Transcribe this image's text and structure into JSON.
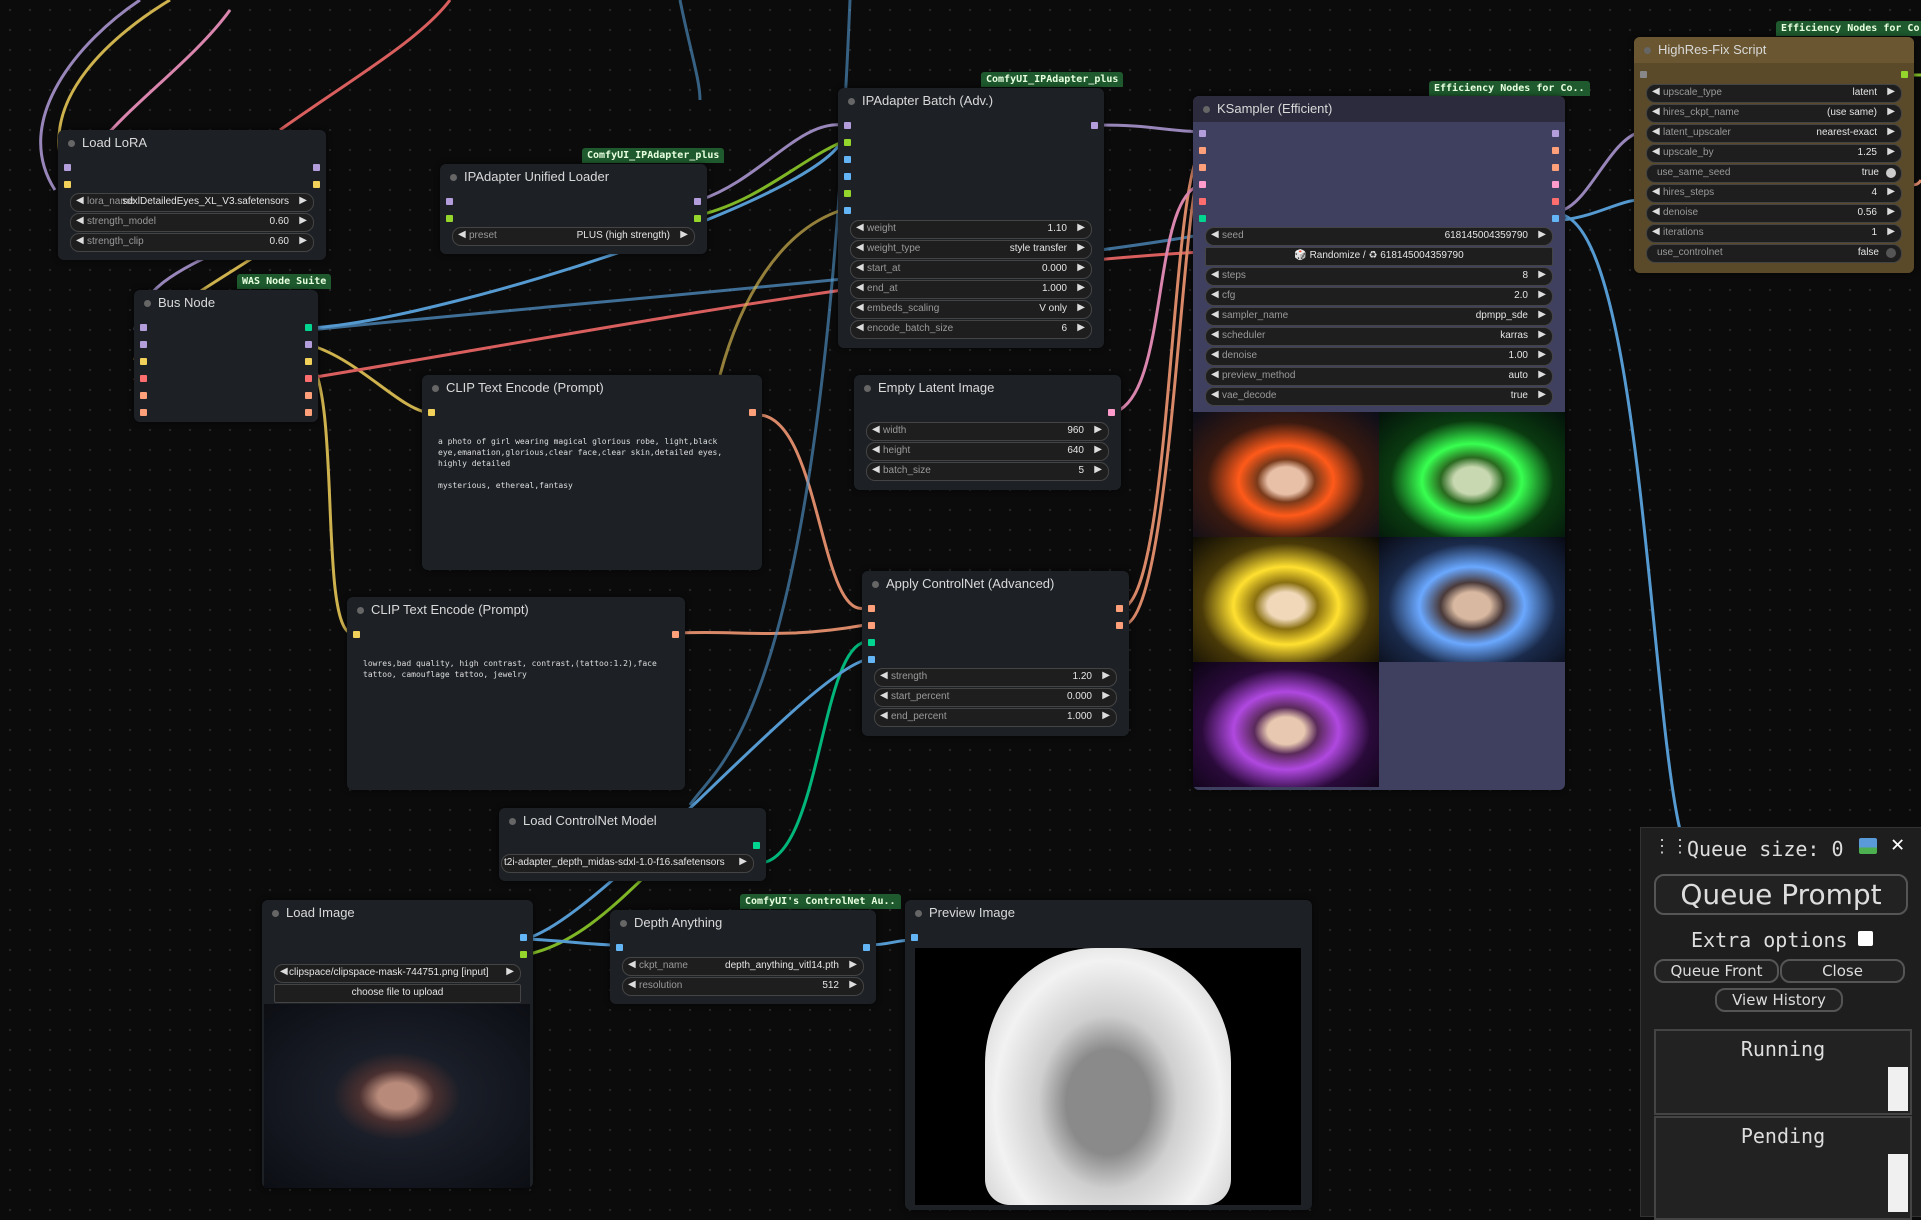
{
  "nodes": {
    "load_lora": {
      "title": "Load LoRA",
      "widgets": [
        {
          "label": "lora_name",
          "value": "sdxlDetailedEyes_XL_V3.safetensors"
        },
        {
          "label": "strength_model",
          "value": "0.60"
        },
        {
          "label": "strength_clip",
          "value": "0.60"
        }
      ]
    },
    "bus_node": {
      "title": "Bus Node",
      "tag": "WAS Node Suite"
    },
    "ipadapter_loader": {
      "title": "IPAdapter Unified Loader",
      "tag": "ComfyUI_IPAdapter_plus",
      "widgets": [
        {
          "label": "preset",
          "value": "PLUS (high strength)"
        }
      ]
    },
    "ipadapter_batch": {
      "title": "IPAdapter Batch (Adv.)",
      "tag": "ComfyUI_IPAdapter_plus",
      "widgets": [
        {
          "label": "weight",
          "value": "1.10"
        },
        {
          "label": "weight_type",
          "value": "style transfer"
        },
        {
          "label": "start_at",
          "value": "0.000"
        },
        {
          "label": "end_at",
          "value": "1.000"
        },
        {
          "label": "embeds_scaling",
          "value": "V only"
        },
        {
          "label": "encode_batch_size",
          "value": "6"
        }
      ]
    },
    "clip_pos": {
      "title": "CLIP Text Encode (Prompt)",
      "text": "a photo of girl wearing magical glorious robe, light,black eye,emanation,glorious,clear face,clear skin,detailed eyes, highly detailed\n\nmysterious, ethereal,fantasy"
    },
    "clip_neg": {
      "title": "CLIP Text Encode (Prompt)",
      "text": "lowres,bad quality, high contrast, contrast,(tattoo:1.2),face tattoo, camouflage tattoo, jewelry"
    },
    "empty_latent": {
      "title": "Empty Latent Image",
      "widgets": [
        {
          "label": "width",
          "value": "960"
        },
        {
          "label": "height",
          "value": "640"
        },
        {
          "label": "batch_size",
          "value": "5"
        }
      ]
    },
    "apply_controlnet": {
      "title": "Apply ControlNet (Advanced)",
      "widgets": [
        {
          "label": "strength",
          "value": "1.20"
        },
        {
          "label": "start_percent",
          "value": "0.000"
        },
        {
          "label": "end_percent",
          "value": "1.000"
        }
      ]
    },
    "ksampler": {
      "title": "KSampler (Efficient)",
      "tag": "Efficiency Nodes for Co..",
      "seed": {
        "label": "seed",
        "value": "618145004359790"
      },
      "randomize": "🎲 Randomize / ♻ 618145004359790",
      "widgets": [
        {
          "label": "steps",
          "value": "8"
        },
        {
          "label": "cfg",
          "value": "2.0"
        },
        {
          "label": "sampler_name",
          "value": "dpmpp_sde"
        },
        {
          "label": "scheduler",
          "value": "karras"
        },
        {
          "label": "denoise",
          "value": "1.00"
        },
        {
          "label": "preview_method",
          "value": "auto"
        },
        {
          "label": "vae_decode",
          "value": "true"
        }
      ]
    },
    "highres": {
      "title": "HighRes-Fix Script",
      "tag": "Efficiency Nodes for Co..",
      "widgets": [
        {
          "label": "upscale_type",
          "value": "latent"
        },
        {
          "label": "hires_ckpt_name",
          "value": "(use same)"
        },
        {
          "label": "latent_upscaler",
          "value": "nearest-exact"
        },
        {
          "label": "upscale_by",
          "value": "1.25"
        },
        {
          "label": "use_same_seed",
          "value": "true"
        },
        {
          "label": "hires_steps",
          "value": "4"
        },
        {
          "label": "denoise",
          "value": "0.56"
        },
        {
          "label": "iterations",
          "value": "1"
        },
        {
          "label": "use_controlnet",
          "value": "false"
        }
      ]
    },
    "load_controlnet": {
      "title": "Load ControlNet Model",
      "widgets": [
        {
          "label": "control_net_name",
          "value": "t2i-adapter_depth_midas-sdxl-1.0-f16.safetensors"
        }
      ]
    },
    "load_image": {
      "title": "Load Image",
      "widgets": [
        {
          "label": "image",
          "value": "clipspace/clipspace-mask-744751.png [input]"
        }
      ],
      "upload": "choose file to upload"
    },
    "depth_anything": {
      "title": "Depth Anything",
      "tag": "ComfyUI's ControlNet Au..",
      "widgets": [
        {
          "label": "ckpt_name",
          "value": "depth_anything_vitl14.pth"
        },
        {
          "label": "resolution",
          "value": "512"
        }
      ]
    },
    "preview_image": {
      "title": "Preview Image"
    }
  },
  "queue_panel": {
    "queue_size": "Queue size: 0",
    "queue_prompt": "Queue Prompt",
    "extra_options": "Extra options",
    "queue_front": "Queue Front",
    "close": "Close",
    "view_history": "View History",
    "running": "Running",
    "pending": "Pending"
  },
  "colors": {
    "clip": "#f2d15b",
    "model": "#b39ddb",
    "conditioning": "#ffa07a",
    "latent": "#ff9ccb",
    "image": "#64b5f6",
    "control_net": "#00d68f",
    "vae": "#ff6e6e",
    "ipadapter": "#94d62c"
  }
}
